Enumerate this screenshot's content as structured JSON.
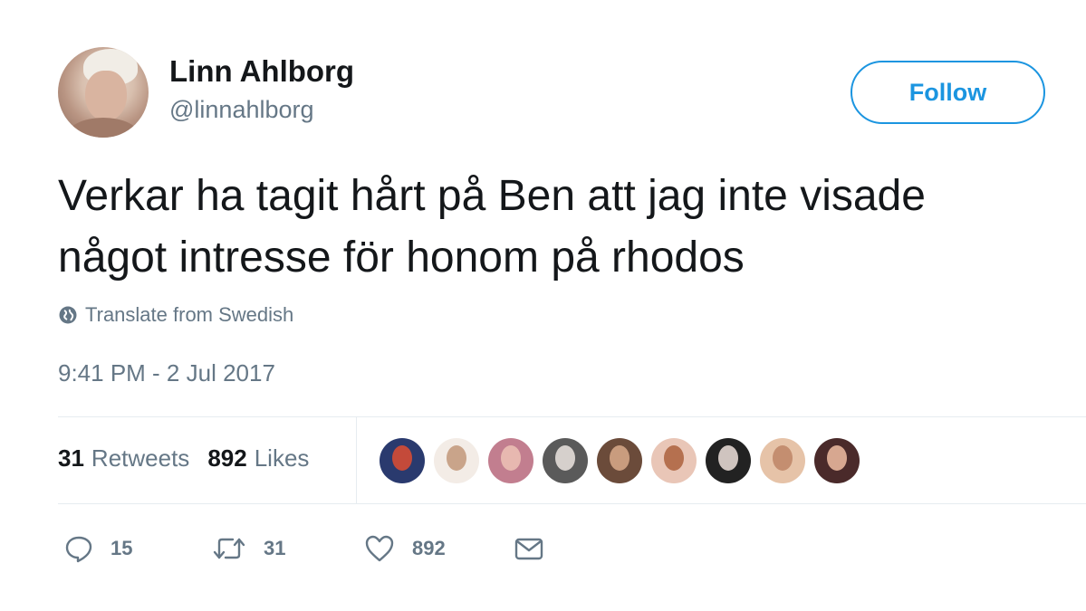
{
  "user": {
    "display_name": "Linn Ahlborg",
    "handle": "@linnahlborg"
  },
  "follow_button": {
    "label": "Follow"
  },
  "tweet": {
    "text_line_1": "Verkar ha tagit hårt på Ben att jag inte visade",
    "text_line_2": "något intresse för honom på rhodos",
    "translate_label": "Translate from Swedish",
    "timestamp": "9:41 PM - 2 Jul 2017"
  },
  "stats": {
    "retweets_count": "31",
    "retweets_label": "Retweets",
    "likes_count": "892",
    "likes_label": "Likes"
  },
  "likers": [
    {
      "bg": "#2a3a6e",
      "head": "#c44a3a"
    },
    {
      "bg": "#f3ece6",
      "head": "#c9a48a"
    },
    {
      "bg": "#c27e8f",
      "head": "#e7b8b0"
    },
    {
      "bg": "#5a5a5a",
      "head": "#d6d0cc"
    },
    {
      "bg": "#6b4b3a",
      "head": "#c99c7e"
    },
    {
      "bg": "#e9c6b7",
      "head": "#b5704f"
    },
    {
      "bg": "#222222",
      "head": "#cfc4bf"
    },
    {
      "bg": "#e6c3a8",
      "head": "#c48e70"
    },
    {
      "bg": "#4a2a2a",
      "head": "#d7a790"
    }
  ],
  "actions": {
    "reply_count": "15",
    "retweet_count": "31",
    "like_count": "892"
  },
  "icons": {
    "reply": "speech-bubble",
    "retweet": "retweet-arrows",
    "like": "heart-outline",
    "dm": "envelope",
    "translate": "globe"
  },
  "colors": {
    "accent": "#1b95e0",
    "text_primary": "#14171a",
    "text_secondary": "#657786",
    "divider": "#e6ecf0"
  }
}
